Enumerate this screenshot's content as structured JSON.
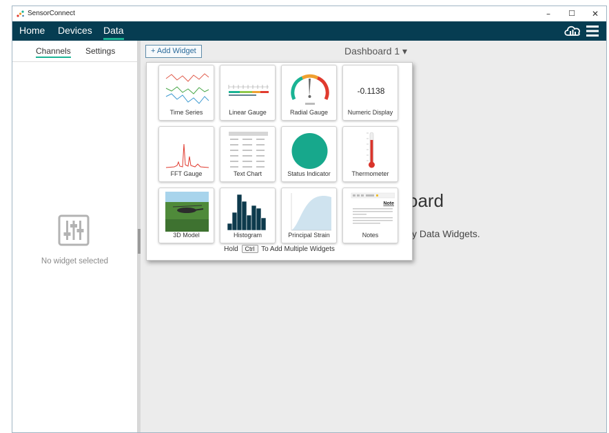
{
  "window": {
    "title": "SensorConnect",
    "controls": {
      "minimize": "–",
      "maximize": "☐",
      "close": "✕"
    }
  },
  "nav": {
    "items": [
      {
        "label": "Home",
        "active": false
      },
      {
        "label": "Devices",
        "active": false
      },
      {
        "label": "Data",
        "active": true
      }
    ],
    "icons": [
      "cloud-upload-icon",
      "hamburger-menu-icon"
    ]
  },
  "sidebar": {
    "tabs": [
      {
        "label": "Channels",
        "active": true
      },
      {
        "label": "Settings",
        "active": false
      }
    ],
    "empty_text": "No widget selected",
    "empty_icon": "sliders-icon"
  },
  "main": {
    "add_widget_label": "+ Add Widget",
    "dashboard_title": "Dashboard 1 ▾",
    "bg_title_fragment": "oard",
    "bg_subtitle_fragment": "y Data Widgets."
  },
  "widget_popup": {
    "widgets": [
      {
        "label": "Time Series"
      },
      {
        "label": "Linear Gauge"
      },
      {
        "label": "Radial Gauge"
      },
      {
        "label": "Numeric Display",
        "preview_value": "-0.1138"
      },
      {
        "label": "FFT Gauge"
      },
      {
        "label": "Text Chart"
      },
      {
        "label": "Status Indicator"
      },
      {
        "label": "Thermometer"
      },
      {
        "label": "3D Model"
      },
      {
        "label": "Histogram"
      },
      {
        "label": "Principal Strain"
      },
      {
        "label": "Notes",
        "preview_heading": "Note"
      }
    ],
    "hint_prefix": "Hold",
    "hint_key": "Ctrl",
    "hint_suffix": "To Add Multiple Widgets"
  },
  "colors": {
    "navbar": "#063d52",
    "accent": "#1ab394",
    "status_indicator": "#17a88c",
    "thermometer": "#d9342b",
    "histogram": "#0d3a4c",
    "strain": "#cfe3ef"
  }
}
